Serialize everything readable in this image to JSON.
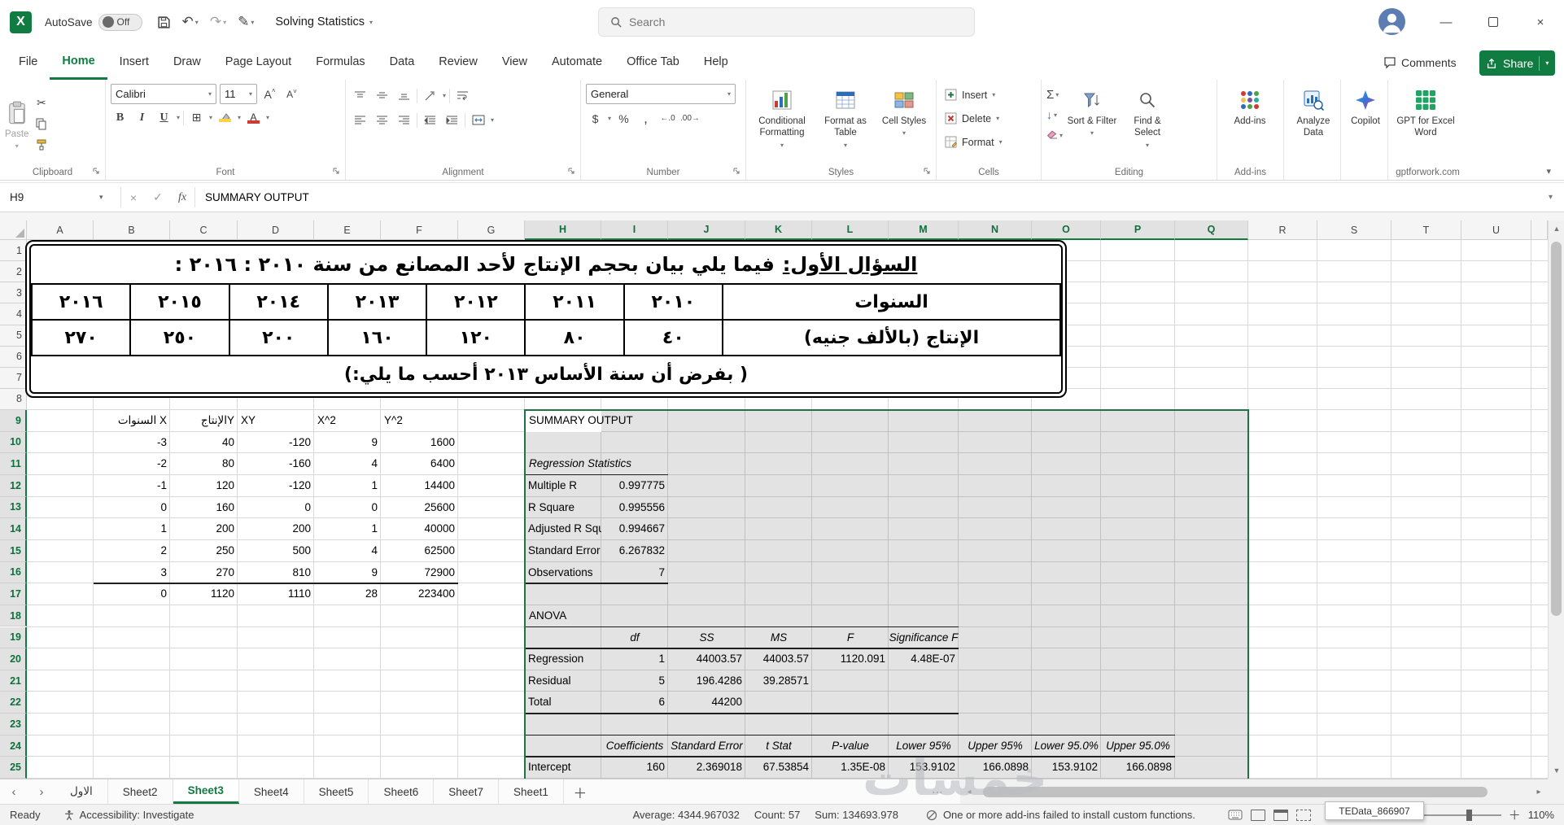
{
  "titlebar": {
    "autosave_label": "AutoSave",
    "autosave_state": "Off",
    "document_title": "Solving Statistics",
    "search_placeholder": "Search"
  },
  "ribbon_tabs": {
    "items": [
      {
        "label": "File"
      },
      {
        "label": "Home",
        "active": true
      },
      {
        "label": "Insert"
      },
      {
        "label": "Draw"
      },
      {
        "label": "Page Layout"
      },
      {
        "label": "Formulas"
      },
      {
        "label": "Data"
      },
      {
        "label": "Review"
      },
      {
        "label": "View"
      },
      {
        "label": "Automate"
      },
      {
        "label": "Office Tab"
      },
      {
        "label": "Help"
      }
    ],
    "comments_label": "Comments",
    "share_label": "Share"
  },
  "ribbon": {
    "paste": "Paste",
    "clipboard_group": "Clipboard",
    "font_name": "Calibri",
    "font_size": "11",
    "font_group": "Font",
    "alignment_group": "Alignment",
    "number_format": "General",
    "number_group": "Number",
    "conditional_formatting": "Conditional Formatting",
    "format_as_table": "Format as Table",
    "cell_styles": "Cell Styles",
    "styles_group": "Styles",
    "insert": "Insert",
    "delete": "Delete",
    "format": "Format",
    "cells_group": "Cells",
    "sort_filter": "Sort & Filter",
    "find_select": "Find & Select",
    "editing_group": "Editing",
    "addins": "Add-ins",
    "addins_group": "Add-ins",
    "analyze_data": "Analyze Data",
    "copilot": "Copilot",
    "gpt": "GPT for Excel Word",
    "gpt_group": "gptforwork.com"
  },
  "formula_bar": {
    "name_box": "H9",
    "formula": "SUMMARY OUTPUT"
  },
  "question_table": {
    "title_lead": "السؤال الأول:",
    "title_rest": "فيما يلي بيان بحجم الإنتاج لأحد المصانع من سنة ٢٠١٠ : ٢٠١٦ :",
    "years_label": "السنوات",
    "years": [
      "٢٠١٦",
      "٢٠١٥",
      "٢٠١٤",
      "٢٠١٣",
      "٢٠١٢",
      "٢٠١١",
      "٢٠١٠"
    ],
    "production_label": "الإنتاج (بالألف جنيه)",
    "production": [
      "٢٧٠",
      "٢٥٠",
      "٢٠٠",
      "١٦٠",
      "١٢٠",
      "٨٠",
      "٤٠"
    ],
    "footnote": "( بفرض أن سنة الأساس ٢٠١٣ أحسب ما يلي:)"
  },
  "data_table": {
    "headers": [
      "السنوات X",
      "الإنتاجY",
      "XY",
      "X^2",
      "Y^2"
    ],
    "rows": [
      [
        "-3",
        "40",
        "-120",
        "9",
        "1600"
      ],
      [
        "-2",
        "80",
        "-160",
        "4",
        "6400"
      ],
      [
        "-1",
        "120",
        "-120",
        "1",
        "14400"
      ],
      [
        "0",
        "160",
        "0",
        "0",
        "25600"
      ],
      [
        "1",
        "200",
        "200",
        "1",
        "40000"
      ],
      [
        "2",
        "250",
        "500",
        "4",
        "62500"
      ],
      [
        "3",
        "270",
        "810",
        "9",
        "72900"
      ],
      [
        "0",
        "1120",
        "1110",
        "28",
        "223400"
      ]
    ]
  },
  "summary_output": {
    "title": "SUMMARY OUTPUT",
    "regression_statistics": {
      "header": "Regression Statistics",
      "rows": [
        [
          "Multiple R",
          "0.997775"
        ],
        [
          "R Square",
          "0.995556"
        ],
        [
          "Adjusted R Square",
          "0.994667"
        ],
        [
          "Standard Error",
          "6.267832"
        ],
        [
          "Observations",
          "7"
        ]
      ]
    },
    "anova": {
      "title": "ANOVA",
      "headers": [
        "df",
        "SS",
        "MS",
        "F",
        "Significance F"
      ],
      "rows": [
        [
          "Regression",
          "1",
          "44003.57",
          "44003.57",
          "1120.091",
          "4.48E-07"
        ],
        [
          "Residual",
          "5",
          "196.4286",
          "39.28571",
          "",
          ""
        ],
        [
          "Total",
          "6",
          "44200",
          "",
          "",
          ""
        ]
      ]
    },
    "coefficients": {
      "headers": [
        "Coefficients",
        "Standard Error",
        "t Stat",
        "P-value",
        "Lower 95%",
        "Upper 95%",
        "Lower 95.0%",
        "Upper 95.0%"
      ],
      "rows": [
        [
          "Intercept",
          "160",
          "2.369018",
          "67.53854",
          "1.35E-08",
          "153.9102",
          "166.0898",
          "153.9102",
          "166.0898"
        ]
      ]
    }
  },
  "grid": {
    "columns": [
      "A",
      "B",
      "C",
      "D",
      "E",
      "F",
      "G",
      "H",
      "I",
      "J",
      "K",
      "L",
      "M",
      "N",
      "O",
      "P",
      "Q",
      "R",
      "S",
      "T",
      "U"
    ],
    "selection": {
      "range": "H9:Q25",
      "active_cell": "H9"
    }
  },
  "sheet_tabs": {
    "items": [
      {
        "label": "الاول"
      },
      {
        "label": "Sheet2"
      },
      {
        "label": "Sheet3",
        "active": true
      },
      {
        "label": "Sheet4"
      },
      {
        "label": "Sheet5"
      },
      {
        "label": "Sheet6"
      },
      {
        "label": "Sheet7"
      },
      {
        "label": "Sheet1"
      }
    ]
  },
  "status_bar": {
    "mode": "Ready",
    "accessibility": "Accessibility: Investigate",
    "average": "Average: 4344.967032",
    "count": "Count: 57",
    "sum": "Sum: 134693.978",
    "addin_warning": "One or more add-ins failed to install custom functions.",
    "zoom": "110%"
  },
  "overlays": {
    "tooltip": "TEData_866907",
    "watermark": "خمسات"
  },
  "colors": {
    "accent_green": "#107C41",
    "selection_border": "#217346"
  }
}
